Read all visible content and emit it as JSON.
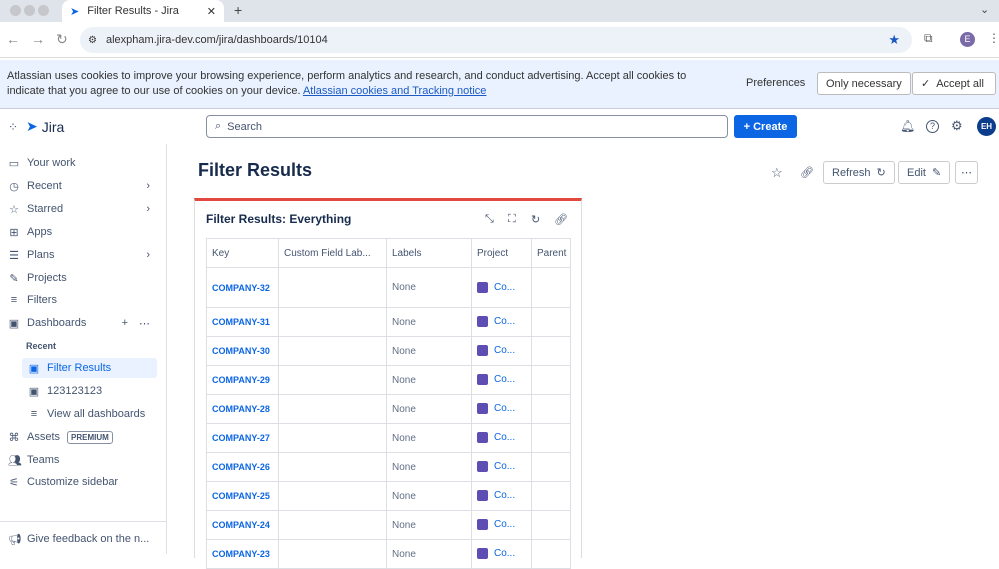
{
  "browser": {
    "tab_title": "Filter Results - Jira",
    "url": "alexpham.jira-dev.com/jira/dashboards/10104",
    "profile": "E"
  },
  "cookie": {
    "text": "Atlassian uses cookies to improve your browsing experience, perform analytics and research, and conduct advertising. Accept all cookies to indicate that you agree to our use of cookies on your device.",
    "link": "Atlassian cookies and Tracking notice",
    "preferences": "Preferences",
    "only_necessary": "Only necessary",
    "accept_all": "Accept all"
  },
  "header": {
    "logo": "Jira",
    "search_placeholder": "Search",
    "create": "+ Create",
    "avatar": "EH"
  },
  "sidebar": {
    "your_work": "Your work",
    "recent": "Recent",
    "starred": "Starred",
    "apps": "Apps",
    "plans": "Plans",
    "projects": "Projects",
    "filters": "Filters",
    "dashboards": "Dashboards",
    "recent_label": "Recent",
    "dash_items": [
      "Filter Results",
      "123123123"
    ],
    "view_all": "View all dashboards",
    "assets": "Assets",
    "premium": "PREMIUM",
    "teams": "Teams",
    "customize": "Customize sidebar",
    "feedback": "Give feedback on the n..."
  },
  "page": {
    "title": "Filter Results",
    "refresh": "Refresh",
    "edit": "Edit"
  },
  "gadget": {
    "title": "Filter Results: Everything",
    "columns": [
      "Key",
      "Custom Field Lab...",
      "Labels",
      "Project",
      "Parent"
    ],
    "rows": [
      {
        "key": "COMPANY-32",
        "labels": "None",
        "project": "Co..."
      },
      {
        "key": "COMPANY-31",
        "labels": "None",
        "project": "Co..."
      },
      {
        "key": "COMPANY-30",
        "labels": "None",
        "project": "Co..."
      },
      {
        "key": "COMPANY-29",
        "labels": "None",
        "project": "Co..."
      },
      {
        "key": "COMPANY-28",
        "labels": "None",
        "project": "Co..."
      },
      {
        "key": "COMPANY-27",
        "labels": "None",
        "project": "Co..."
      },
      {
        "key": "COMPANY-26",
        "labels": "None",
        "project": "Co..."
      },
      {
        "key": "COMPANY-25",
        "labels": "None",
        "project": "Co..."
      },
      {
        "key": "COMPANY-24",
        "labels": "None",
        "project": "Co..."
      },
      {
        "key": "COMPANY-23",
        "labels": "None",
        "project": "Co..."
      }
    ]
  }
}
